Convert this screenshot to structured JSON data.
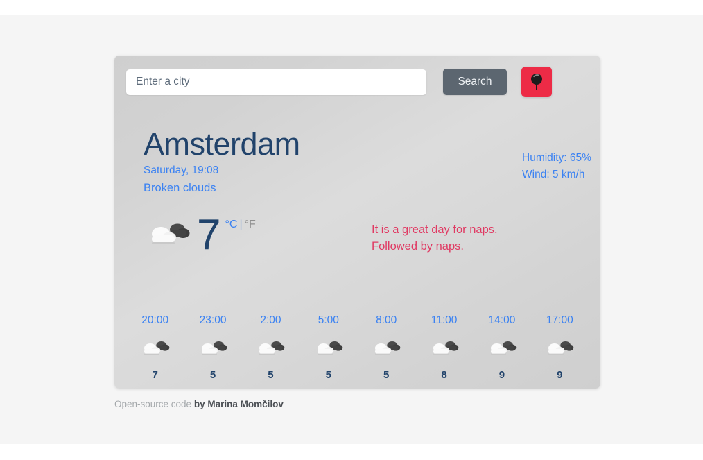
{
  "search": {
    "placeholder": "Enter a city",
    "value": "",
    "search_label": "Search",
    "location_icon": "map-pin-icon"
  },
  "current": {
    "city": "Amsterdam",
    "datetime": "Saturday, 19:08",
    "description": "Broken clouds",
    "humidity_label": "Humidity: 65%",
    "wind_label": "Wind: 5 km/h",
    "temperature": "7",
    "unit_celsius": "°C",
    "unit_separator": "|",
    "unit_fahrenheit": "°F",
    "icon": "broken-clouds-icon"
  },
  "message": {
    "line1": "It is a great day for naps.",
    "line2": "Followed by naps."
  },
  "forecast": [
    {
      "time": "20:00",
      "temp": "7",
      "icon": "broken-clouds-icon"
    },
    {
      "time": "23:00",
      "temp": "5",
      "icon": "broken-clouds-icon"
    },
    {
      "time": "2:00",
      "temp": "5",
      "icon": "broken-clouds-icon"
    },
    {
      "time": "5:00",
      "temp": "5",
      "icon": "broken-clouds-icon"
    },
    {
      "time": "8:00",
      "temp": "5",
      "icon": "broken-clouds-icon"
    },
    {
      "time": "11:00",
      "temp": "8",
      "icon": "broken-clouds-icon"
    },
    {
      "time": "14:00",
      "temp": "9",
      "icon": "broken-clouds-icon"
    },
    {
      "time": "17:00",
      "temp": "9",
      "icon": "broken-clouds-icon"
    }
  ],
  "footer": {
    "link_text": "Open-source code",
    "author_text": "by Marina Momčilov"
  },
  "colors": {
    "accent_red": "#ed2b46",
    "search_gray": "#5c6670",
    "link_blue": "#3b82f2",
    "title_navy": "#21436b",
    "message_pink": "#e03a63"
  }
}
